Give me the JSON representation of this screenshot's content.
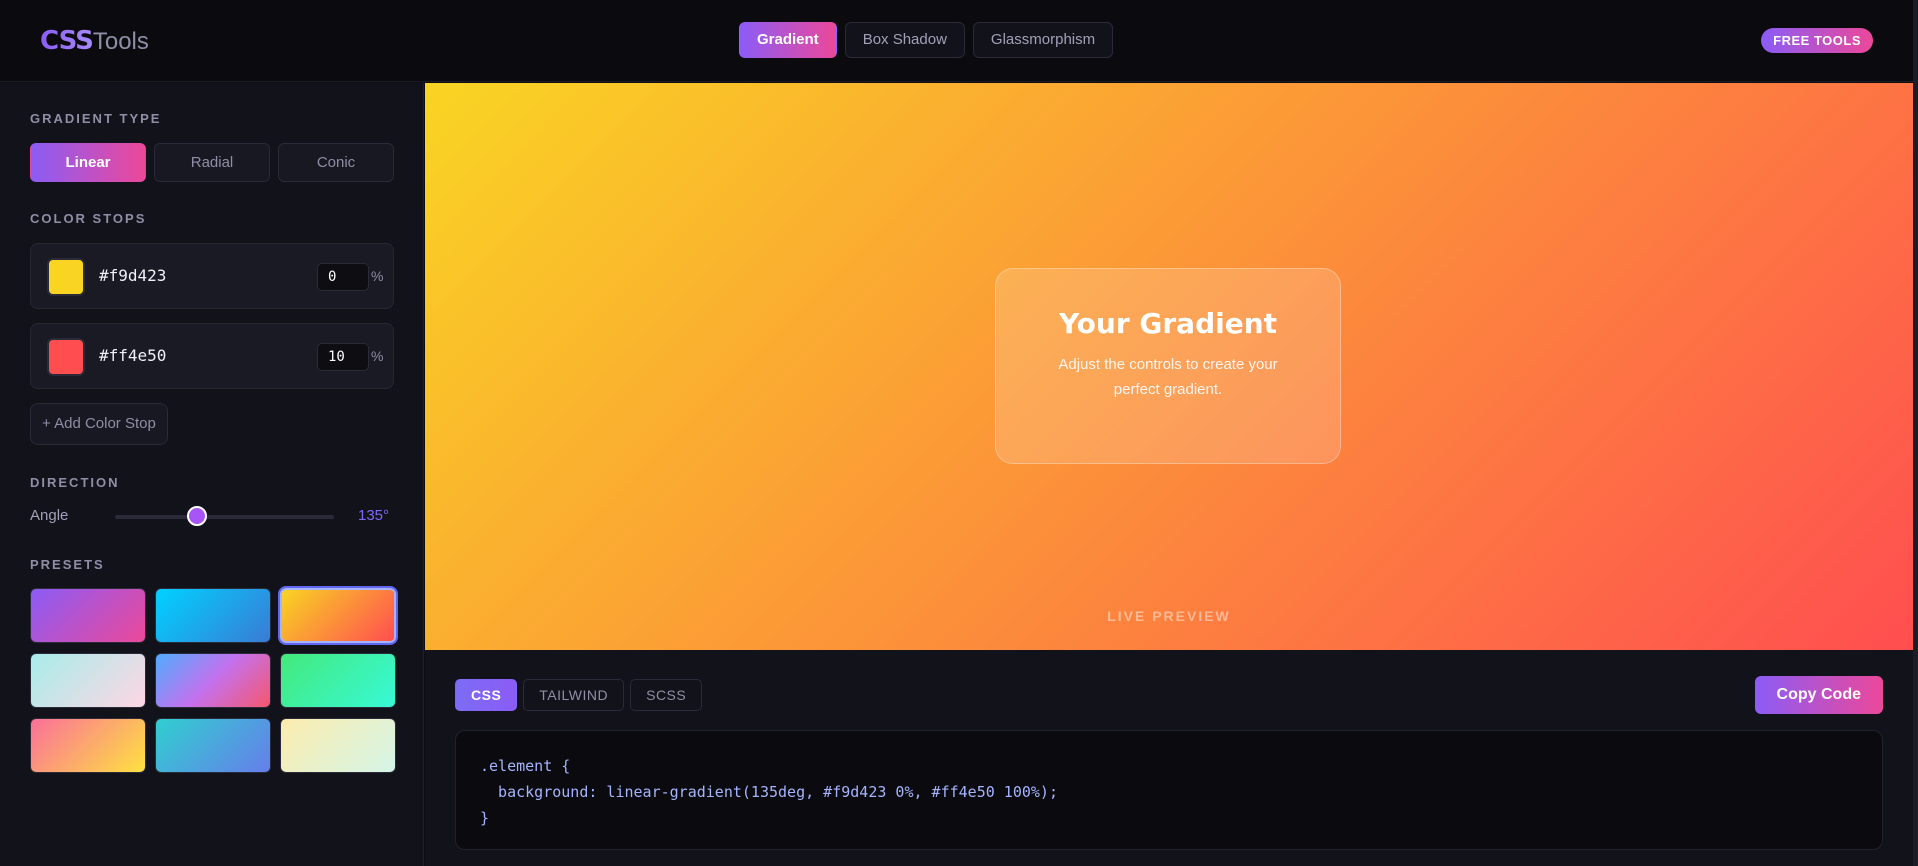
{
  "header": {
    "logo_bold": "CSS",
    "logo_light": "Tools",
    "tabs": [
      {
        "label": "Gradient",
        "active": true
      },
      {
        "label": "Box Shadow",
        "active": false
      },
      {
        "label": "Glassmorphism",
        "active": false
      }
    ],
    "badge": "FREE TOOLS"
  },
  "sidebar": {
    "gradient_type_label": "GRADIENT TYPE",
    "types": [
      {
        "label": "Linear",
        "active": true
      },
      {
        "label": "Radial",
        "active": false
      },
      {
        "label": "Conic",
        "active": false
      }
    ],
    "color_stops_label": "COLOR STOPS",
    "stops": [
      {
        "color": "#f9d423",
        "position": "0",
        "unit": "%"
      },
      {
        "color": "#ff4e50",
        "position": "10",
        "unit": "%"
      }
    ],
    "add_stop_label": "+ Add Color Stop",
    "direction_label": "DIRECTION",
    "angle_label": "Angle",
    "angle_value": "135°",
    "angle_degrees": 135,
    "presets_label": "PRESETS",
    "presets": [
      {
        "from": "#8b5cf6",
        "to": "#ec4899",
        "active": false
      },
      {
        "from": "#00d2ff",
        "to": "#3a7bd5",
        "active": false
      },
      {
        "from": "#f9d423",
        "to": "#ff4e50",
        "active": true
      },
      {
        "from": "#a8edea",
        "to": "#fed6e3",
        "active": false
      },
      {
        "from": "#4facfe",
        "to": "#f5576c",
        "mid": "#c471ed",
        "active": false
      },
      {
        "from": "#43e97b",
        "to": "#38f9d7",
        "active": false
      },
      {
        "from": "#fa709a",
        "to": "#fee140",
        "active": false
      },
      {
        "from": "#30cfd0",
        "to": "#667eea",
        "active": false
      },
      {
        "from": "#fcecad",
        "to": "#d5f5e8",
        "active": false
      }
    ]
  },
  "preview": {
    "card_title": "Your Gradient",
    "card_subtitle": "Adjust the controls to create your perfect gradient.",
    "live_label": "LIVE PREVIEW"
  },
  "code": {
    "tabs": [
      {
        "label": "CSS",
        "active": true
      },
      {
        "label": "TAILWIND",
        "active": false
      },
      {
        "label": "SCSS",
        "active": false
      }
    ],
    "copy_label": "Copy Code",
    "lines": [
      ".element {",
      "  background: linear-gradient(135deg, #f9d423 0%, #ff4e50 100%);",
      "}"
    ]
  },
  "colors": {
    "accent_from": "#8b5cf6",
    "accent_to": "#ec4899",
    "angle_text": "#7c6cf5"
  }
}
